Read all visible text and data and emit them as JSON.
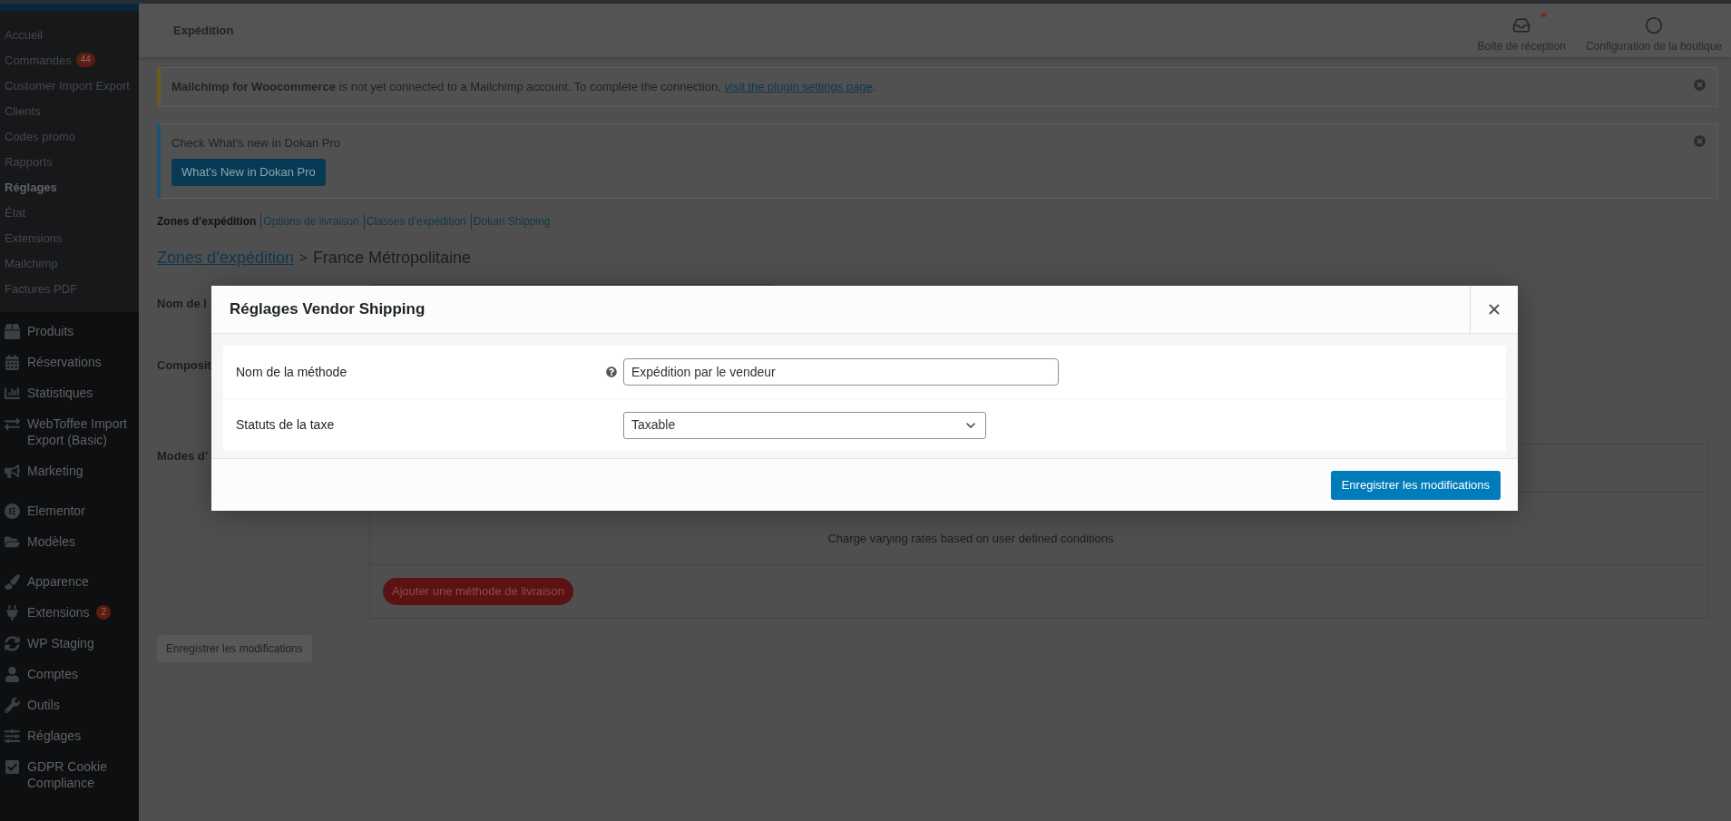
{
  "sidebar": {
    "submenu": [
      {
        "label": "Accueil",
        "selected": false
      },
      {
        "label": "Commandes",
        "selected": false,
        "badge": "44"
      },
      {
        "label": "Customer Import Export",
        "selected": false
      },
      {
        "label": "Clients",
        "selected": false
      },
      {
        "label": "Codes promo",
        "selected": false
      },
      {
        "label": "Rapports",
        "selected": false
      },
      {
        "label": "Réglages",
        "selected": true
      },
      {
        "label": "État",
        "selected": false
      },
      {
        "label": "Extensions",
        "selected": false
      },
      {
        "label": "Mailchimp",
        "selected": false
      },
      {
        "label": "Factures PDF",
        "selected": false
      }
    ],
    "menu_groups": [
      {
        "items": [
          {
            "label": "Produits"
          },
          {
            "label": "Réservations"
          },
          {
            "label": "Statistiques"
          },
          {
            "label": "WebToffee Import Export (Basic)"
          },
          {
            "label": "Marketing"
          }
        ]
      },
      {
        "items": [
          {
            "label": "Elementor"
          },
          {
            "label": "Modèles"
          }
        ]
      },
      {
        "items": [
          {
            "label": "Apparence"
          },
          {
            "label": "Extensions",
            "badge": "2"
          },
          {
            "label": "WP Staging"
          },
          {
            "label": "Comptes"
          },
          {
            "label": "Outils"
          },
          {
            "label": "Réglages"
          },
          {
            "label": "GDPR Cookie Compliance"
          }
        ]
      }
    ]
  },
  "header": {
    "title": "Expédition",
    "activity": [
      {
        "label": "Boîte de réception",
        "unread": true
      },
      {
        "label": "Configuration de la boutique",
        "unread": false
      }
    ]
  },
  "notices": [
    {
      "kind": "warning",
      "text": "**Mailchimp for Woocommerce** is not yet connected to a Mailchimp account. To complete the connection, ",
      "link": "visit the plugin settings page",
      "after": "."
    },
    {
      "kind": "info",
      "text": "Check What's new in Dokan Pro",
      "button": "What's New in Dokan Pro"
    }
  ],
  "tabs": [
    {
      "label": "Zones d’expédition",
      "selected": true
    },
    {
      "label": "Options de livraison",
      "selected": false
    },
    {
      "label": "Classes d’expédition",
      "selected": false
    },
    {
      "label": "Dokan Shipping",
      "selected": false
    }
  ],
  "breadcrumb": {
    "link": "Zones d’expédition",
    "separator": ">",
    "current": "France Métropolitaine"
  },
  "form_labels": [
    "Nom de l",
    "Composit",
    "Modes d’"
  ],
  "methods": {
    "description": "Charge varying rates based on user defined conditions",
    "add_button": "Ajouter une méthode de livraison"
  },
  "save_button": "Enregistrer les modifications",
  "modal": {
    "title": "Réglages Vendor Shipping",
    "fields": [
      {
        "kind": "text",
        "label": "Nom de la méthode",
        "help": true,
        "value": "Expédition par le vendeur"
      },
      {
        "kind": "select",
        "label": "Statuts de la taxe",
        "help": false,
        "value": "Taxable"
      }
    ],
    "save_button": "Enregistrer les modifications"
  }
}
